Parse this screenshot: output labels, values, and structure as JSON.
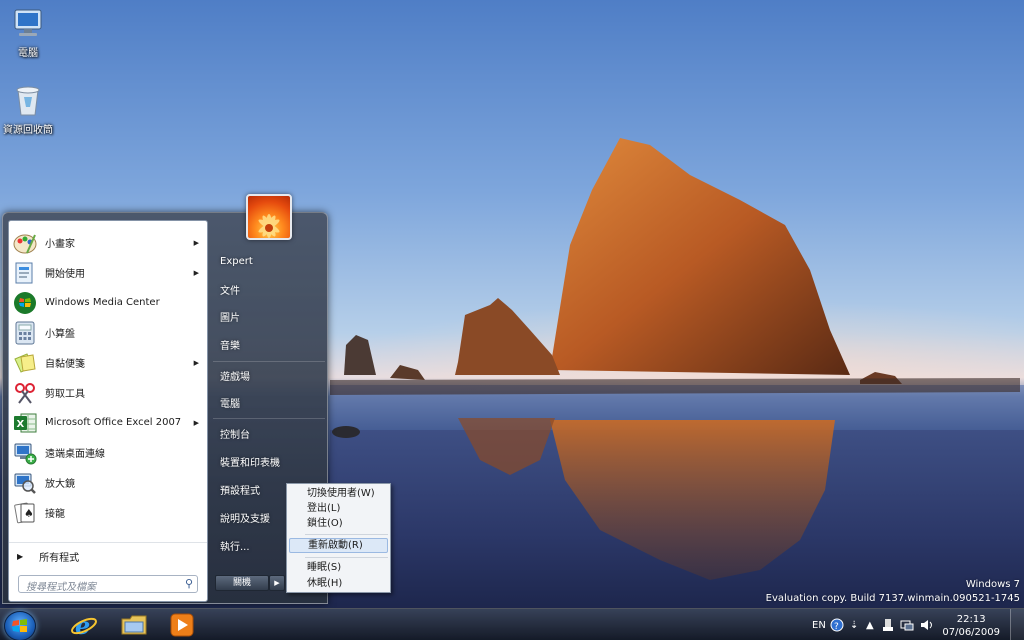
{
  "desktop": {
    "icons": [
      {
        "label": "電腦",
        "icon": "computer-icon"
      },
      {
        "label": "資源回收筒",
        "icon": "recycle-bin-icon"
      }
    ]
  },
  "start_menu": {
    "programs": [
      {
        "label": "小畫家",
        "icon": "paint-icon",
        "has_submenu": true
      },
      {
        "label": "開始使用",
        "icon": "getting-started-icon",
        "has_submenu": true
      },
      {
        "label": "Windows Media Center",
        "icon": "media-center-icon",
        "has_submenu": false
      },
      {
        "label": "小算盤",
        "icon": "calculator-icon",
        "has_submenu": false
      },
      {
        "label": "自黏便箋",
        "icon": "sticky-notes-icon",
        "has_submenu": true
      },
      {
        "label": "剪取工具",
        "icon": "snipping-tool-icon",
        "has_submenu": false
      },
      {
        "label": "Microsoft Office Excel 2007",
        "icon": "excel-icon",
        "has_submenu": true
      },
      {
        "label": "遠端桌面連線",
        "icon": "remote-desktop-icon",
        "has_submenu": false
      },
      {
        "label": "放大鏡",
        "icon": "magnifier-icon",
        "has_submenu": false
      },
      {
        "label": "接龍",
        "icon": "solitaire-icon",
        "has_submenu": false
      }
    ],
    "all_programs": "所有程式",
    "search_placeholder": "搜尋程式及檔案",
    "right_items": [
      "Expert",
      "文件",
      "圖片",
      "音樂",
      "遊戲場",
      "電腦",
      "控制台",
      "裝置和印表機",
      "預設程式",
      "說明及支援",
      "執行..."
    ],
    "shutdown_label": "關機"
  },
  "context_menu": {
    "items": [
      "切換使用者(W)",
      "登出(L)",
      "鎖住(O)",
      "重新啟動(R)",
      "睡眠(S)",
      "休眠(H)"
    ],
    "selected": "重新啟動(R)"
  },
  "watermark": {
    "line1": "Windows 7",
    "line2": "Evaluation copy. Build 7137.winmain.090521-1745"
  },
  "taskbar": {
    "pinned": [
      "internet-explorer-icon",
      "windows-explorer-icon",
      "media-player-icon"
    ],
    "language": "EN",
    "time": "22:13",
    "date": "07/06/2009"
  },
  "colors": {
    "sky_top": "#4f7ec6",
    "context_highlight": "#dce8f7",
    "start_orb": "#1b5fb8"
  }
}
